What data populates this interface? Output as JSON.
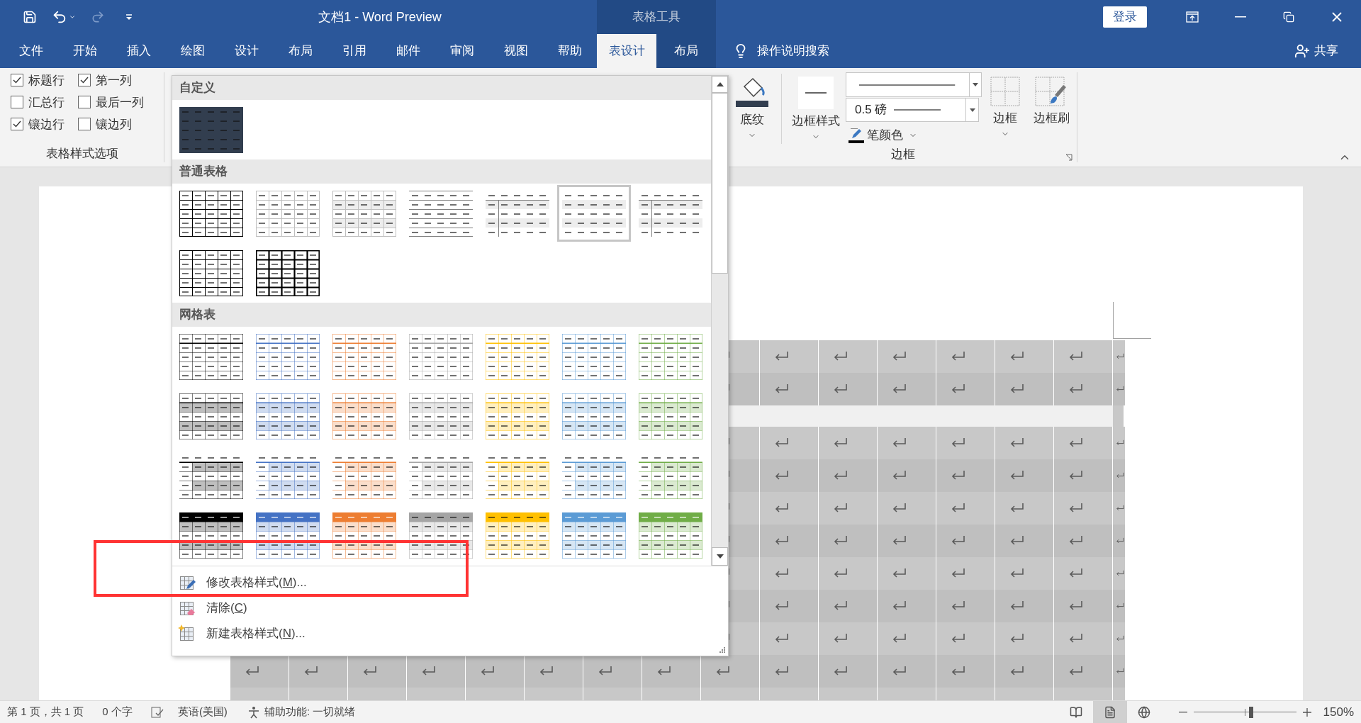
{
  "title_bar": {
    "title": "文档1  -  Word Preview",
    "context_label": "表格工具",
    "sign_in": "登录"
  },
  "quick_access": [
    {
      "kind": "save",
      "disabled": false
    },
    {
      "kind": "undo",
      "disabled": false
    },
    {
      "kind": "redo",
      "disabled": true
    },
    {
      "kind": "customize",
      "disabled": false
    }
  ],
  "tabs": [
    {
      "label": "文件",
      "selected": false,
      "contextual": false
    },
    {
      "label": "开始",
      "selected": false,
      "contextual": false
    },
    {
      "label": "插入",
      "selected": false,
      "contextual": false
    },
    {
      "label": "绘图",
      "selected": false,
      "contextual": false
    },
    {
      "label": "设计",
      "selected": false,
      "contextual": false
    },
    {
      "label": "布局",
      "selected": false,
      "contextual": false
    },
    {
      "label": "引用",
      "selected": false,
      "contextual": false
    },
    {
      "label": "邮件",
      "selected": false,
      "contextual": false
    },
    {
      "label": "审阅",
      "selected": false,
      "contextual": false
    },
    {
      "label": "视图",
      "selected": false,
      "contextual": false
    },
    {
      "label": "帮助",
      "selected": false,
      "contextual": false
    },
    {
      "label": "表设计",
      "selected": true,
      "contextual": true
    },
    {
      "label": "布局",
      "selected": false,
      "contextual": true
    }
  ],
  "tell_me": "操作说明搜索",
  "share": "共享",
  "style_options": {
    "group_label": "表格样式选项",
    "items": [
      {
        "label": "标题行",
        "checked": true
      },
      {
        "label": "第一列",
        "checked": true
      },
      {
        "label": "汇总行",
        "checked": false
      },
      {
        "label": "最后一列",
        "checked": false
      },
      {
        "label": "镶边行",
        "checked": true
      },
      {
        "label": "镶边列",
        "checked": false
      }
    ]
  },
  "gallery": {
    "sections": [
      {
        "title": "自定义",
        "styles": [
          {
            "kind": "custom",
            "color": "#323e4f",
            "selected": false
          }
        ]
      },
      {
        "title": "普通表格",
        "styles": [
          {
            "kind": "grid",
            "selected": false
          },
          {
            "kind": "grid-light",
            "selected": false
          },
          {
            "kind": "grid-banded",
            "selected": false
          },
          {
            "kind": "horizontal",
            "selected": false
          },
          {
            "kind": "banded-lined",
            "selected": false
          },
          {
            "kind": "banded",
            "selected": true
          },
          {
            "kind": "banded-lined",
            "selected": false
          },
          {
            "kind": "grid",
            "selected": false
          },
          {
            "kind": "grid-bold",
            "selected": false
          }
        ]
      },
      {
        "title": "网格表",
        "styles": [
          {
            "kind": "gt-light",
            "color": "#000000",
            "selected": false
          },
          {
            "kind": "gt-light",
            "color": "#4472c4",
            "selected": false
          },
          {
            "kind": "gt-light",
            "color": "#ed7d31",
            "selected": false
          },
          {
            "kind": "gt-light",
            "color": "#a5a5a5",
            "selected": false
          },
          {
            "kind": "gt-light",
            "color": "#ffc000",
            "selected": false
          },
          {
            "kind": "gt-light",
            "color": "#5b9bd5",
            "selected": false
          },
          {
            "kind": "gt-light",
            "color": "#70ad47",
            "selected": false
          },
          {
            "kind": "gt-banded",
            "color": "#000000",
            "selected": false
          },
          {
            "kind": "gt-banded",
            "color": "#4472c4",
            "selected": false
          },
          {
            "kind": "gt-banded",
            "color": "#ed7d31",
            "selected": false
          },
          {
            "kind": "gt-banded",
            "color": "#a5a5a5",
            "selected": false
          },
          {
            "kind": "gt-banded",
            "color": "#ffc000",
            "selected": false
          },
          {
            "kind": "gt-banded",
            "color": "#5b9bd5",
            "selected": false
          },
          {
            "kind": "gt-banded",
            "color": "#70ad47",
            "selected": false
          },
          {
            "kind": "gt-header",
            "color": "#000000",
            "selected": false
          },
          {
            "kind": "gt-header",
            "color": "#4472c4",
            "selected": false
          },
          {
            "kind": "gt-header",
            "color": "#ed7d31",
            "selected": false
          },
          {
            "kind": "gt-header",
            "color": "#a5a5a5",
            "selected": false
          },
          {
            "kind": "gt-header",
            "color": "#ffc000",
            "selected": false
          },
          {
            "kind": "gt-header",
            "color": "#5b9bd5",
            "selected": false
          },
          {
            "kind": "gt-header",
            "color": "#70ad47",
            "selected": false
          },
          {
            "kind": "gt-dark",
            "color": "#000000",
            "selected": false
          },
          {
            "kind": "gt-dark",
            "color": "#4472c4",
            "selected": false
          },
          {
            "kind": "gt-dark",
            "color": "#ed7d31",
            "selected": false
          },
          {
            "kind": "gt-dark",
            "color": "#a5a5a5",
            "selected": false
          },
          {
            "kind": "gt-dark",
            "color": "#ffc000",
            "selected": false
          },
          {
            "kind": "gt-dark",
            "color": "#5b9bd5",
            "selected": false
          },
          {
            "kind": "gt-dark",
            "color": "#70ad47",
            "selected": false
          }
        ]
      }
    ],
    "menu": [
      {
        "kind": "modify",
        "before": "修改表格样式(",
        "key": "M",
        "after": ")..."
      },
      {
        "kind": "clear",
        "before": "清除(",
        "key": "C",
        "after": ")"
      },
      {
        "kind": "new",
        "before": "新建表格样式(",
        "key": "N",
        "after": ")..."
      }
    ]
  },
  "borders": {
    "shading_label": "底纹",
    "border_styles_label": "边框样式",
    "line_weight": "0.5 磅",
    "pen_color_label": "笔颜色",
    "borders_label": "边框",
    "painter_label": "边框刷",
    "group_label": "边框"
  },
  "status_bar": {
    "page": "第 1 页，共 1 页",
    "words": "0 个字",
    "language": "英语(美国)",
    "accessibility": "辅助功能: 一切就绪",
    "views": [
      {
        "kind": "read",
        "selected": false
      },
      {
        "kind": "print",
        "selected": true
      },
      {
        "kind": "web",
        "selected": false
      }
    ],
    "zoom": {
      "level": 0.56,
      "reading": "150%"
    }
  }
}
